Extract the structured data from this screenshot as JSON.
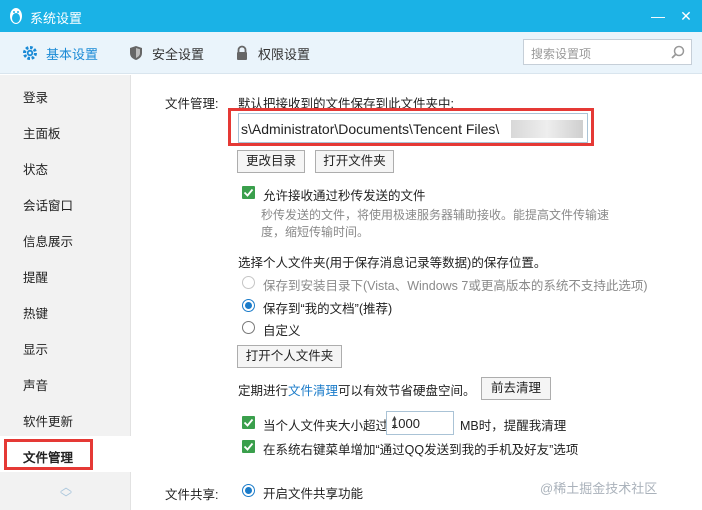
{
  "window": {
    "title": "系统设置",
    "minimize": "—",
    "close": "✕"
  },
  "tabs": [
    {
      "label": "基本设置",
      "icon": "gear-icon"
    },
    {
      "label": "安全设置",
      "icon": "shield-icon"
    },
    {
      "label": "权限设置",
      "icon": "lock-icon"
    }
  ],
  "search": {
    "placeholder": "搜索设置项"
  },
  "sidebar": {
    "items": [
      "登录",
      "主面板",
      "状态",
      "会话窗口",
      "信息展示",
      "提醒",
      "热键",
      "显示",
      "声音",
      "软件更新",
      "文件管理"
    ],
    "selected": "文件管理"
  },
  "file_mgmt": {
    "section_label": "文件管理:",
    "save_desc": "默认把接收到的文件保存到此文件夹中:",
    "path_value": "s\\Administrator\\Documents\\Tencent Files\\",
    "path_tail": "",
    "change_dir": "更改目录",
    "open_folder": "打开文件夹",
    "allow_label": "允许接收通过秒传发送的文件",
    "allow_desc_1": "秒传发送的文件，将使用极速服务器辅助接收。能提高文件传输速",
    "allow_desc_2": "度，缩短传输时间。",
    "personal_desc": "选择个人文件夹(用于保存消息记录等数据)的保存位置。",
    "opt_install": "保存到安装目录下(Vista、Windows 7或更高版本的系统不支持此选项)",
    "opt_docs": "保存到“我的文档”(推荐)",
    "opt_custom": "自定义",
    "open_personal": "打开个人文件夹",
    "clean_prefix": "定期进行",
    "clean_link": "文件清理",
    "clean_suffix": "可以有效节省硬盘空间。",
    "clean_button": "前去清理",
    "size_prefix": "当个人文件夹大小超过",
    "size_value": "1000",
    "size_suffix": "MB时，提醒我清理",
    "context_menu": "在系统右键菜单增加“通过QQ发送到我的手机及好友”选项"
  },
  "share": {
    "section_label": "文件共享:",
    "enable_label": "开启文件共享功能"
  },
  "watermark": "@稀土掘金技术社区",
  "colors": {
    "titlebar": "#1ab2e6",
    "accent": "#1a8ad6",
    "highlight": "#e53935",
    "check": "#3a9f4c"
  }
}
